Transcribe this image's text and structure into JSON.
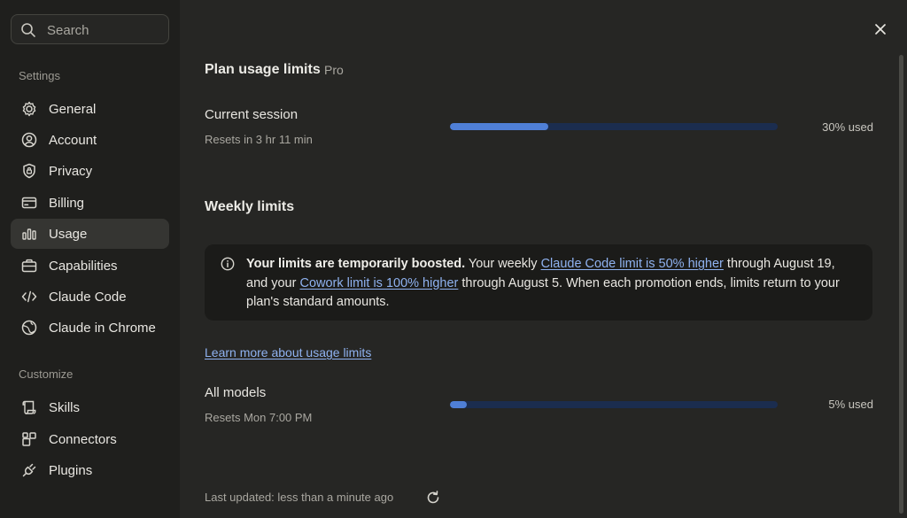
{
  "sidebar": {
    "search_placeholder": "Search",
    "settings_label": "Settings",
    "settings_items": [
      {
        "label": "General",
        "icon": "gear-icon"
      },
      {
        "label": "Account",
        "icon": "user-circle-icon"
      },
      {
        "label": "Privacy",
        "icon": "lock-shield-icon"
      },
      {
        "label": "Billing",
        "icon": "credit-card-icon"
      },
      {
        "label": "Usage",
        "icon": "bar-chart-icon",
        "active": true
      },
      {
        "label": "Capabilities",
        "icon": "briefcase-icon"
      },
      {
        "label": "Claude Code",
        "icon": "code-icon"
      },
      {
        "label": "Claude in Chrome",
        "icon": "globe-icon"
      }
    ],
    "customize_label": "Customize",
    "customize_items": [
      {
        "label": "Skills",
        "icon": "scroll-icon"
      },
      {
        "label": "Connectors",
        "icon": "puzzle-icon"
      },
      {
        "label": "Plugins",
        "icon": "plug-icon"
      }
    ]
  },
  "main": {
    "plan_title": "Plan usage limits",
    "plan_name": "Pro",
    "current_session": {
      "title": "Current session",
      "subtitle": "Resets in 3 hr 11 min",
      "percent_label": "30% used",
      "percent": 30
    },
    "weekly_title": "Weekly limits",
    "notice": {
      "bold": "Your limits are temporarily boosted.",
      "text1": " Your weekly ",
      "link1": "Claude Code limit is 50% higher",
      "text2": " through August 19, and your ",
      "link2": "Cowork limit is 100% higher",
      "text3": " through August 5. When each promotion ends, limits return to your plan's standard amounts."
    },
    "learn_more": "Learn more about usage limits",
    "all_models": {
      "title": "All models",
      "subtitle": "Resets Mon 7:00 PM",
      "percent_label": "5% used",
      "percent": 5
    },
    "last_updated": "Last updated: less than a minute ago"
  },
  "colors": {
    "accent": "#4f7fd6",
    "track": "#1b2d4f",
    "link": "#8fb2f0"
  }
}
